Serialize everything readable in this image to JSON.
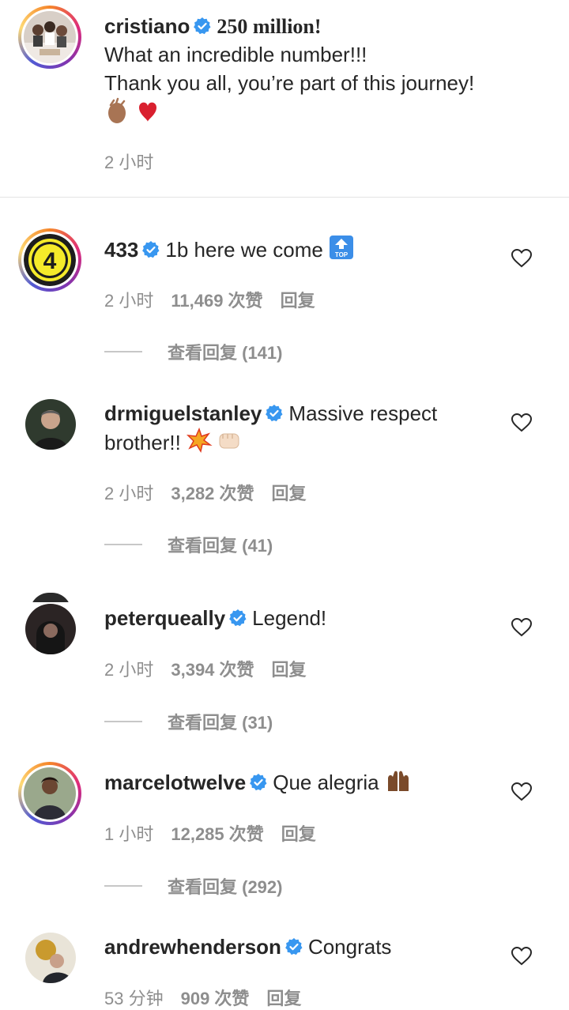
{
  "post": {
    "username": "cristiano",
    "headline": "250 million!",
    "lines": [
      "What an incredible number!!!",
      "Thank you all, you’re part of this journey!"
    ],
    "time": "2 小时"
  },
  "comments": [
    {
      "username": "433",
      "text": "1b here we come",
      "time": "2 小时",
      "likes": "11,469 次赞",
      "reply": "回复",
      "view_replies": "查看回复 (141)"
    },
    {
      "username": "drmiguelstanley",
      "text": "Massive respect",
      "text2": "brother!!",
      "time": "2 小时",
      "likes": "3,282 次赞",
      "reply": "回复",
      "view_replies": "查看回复 (41)"
    },
    {
      "username": "peterqueally",
      "text": "Legend!",
      "time": "2 小时",
      "likes": "3,394 次赞",
      "reply": "回复",
      "view_replies": "查看回复 (31)"
    },
    {
      "username": "marcelotwelve",
      "text": "Que alegria",
      "time": "1 小时",
      "likes": "12,285 次赞",
      "reply": "回复",
      "view_replies": "查看回复 (292)"
    },
    {
      "username": "andrewhenderson",
      "text": "Congrats",
      "time": "53 分钟",
      "likes": "909 次赞",
      "reply": "回复"
    }
  ],
  "colors": {
    "verified": "#3897f0",
    "secondary": "#8e8e8e",
    "text": "#262626"
  }
}
